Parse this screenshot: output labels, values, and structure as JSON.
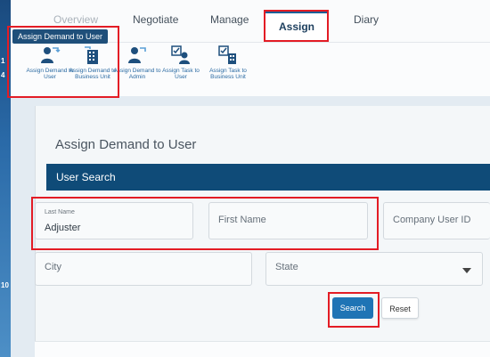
{
  "nav": {
    "tabs": [
      "Overview",
      "Negotiate",
      "Manage",
      "Assign",
      "Diary"
    ]
  },
  "tooltip": "Assign Demand to User",
  "toolbar": {
    "items": [
      {
        "label": "Assign Demand to User",
        "icon": "user-transfer-icon"
      },
      {
        "label": "Assign Demand to Business Unit",
        "icon": "building-transfer-icon"
      },
      {
        "label": "Assign Demand to Admin",
        "icon": "admin-transfer-icon"
      },
      {
        "label": "Assign Task to User",
        "icon": "task-user-icon"
      },
      {
        "label": "Assign Task to Business Unit",
        "icon": "task-building-icon"
      }
    ]
  },
  "left_strip": [
    "1",
    "4",
    "10"
  ],
  "page": {
    "title": "Assign Demand to User",
    "section": "User Search"
  },
  "form": {
    "last_name": {
      "caption": "Last Name",
      "value": "Adjuster"
    },
    "first_name": {
      "placeholder": "First Name"
    },
    "company_user_id": {
      "placeholder": "Company User ID"
    },
    "city": {
      "placeholder": "City"
    },
    "state": {
      "placeholder": "State"
    }
  },
  "buttons": {
    "search": "Search",
    "reset": "Reset"
  },
  "colors": {
    "brand_dark": "#0f4b78",
    "accent": "#1f74b5",
    "highlight": "#e31c25"
  }
}
